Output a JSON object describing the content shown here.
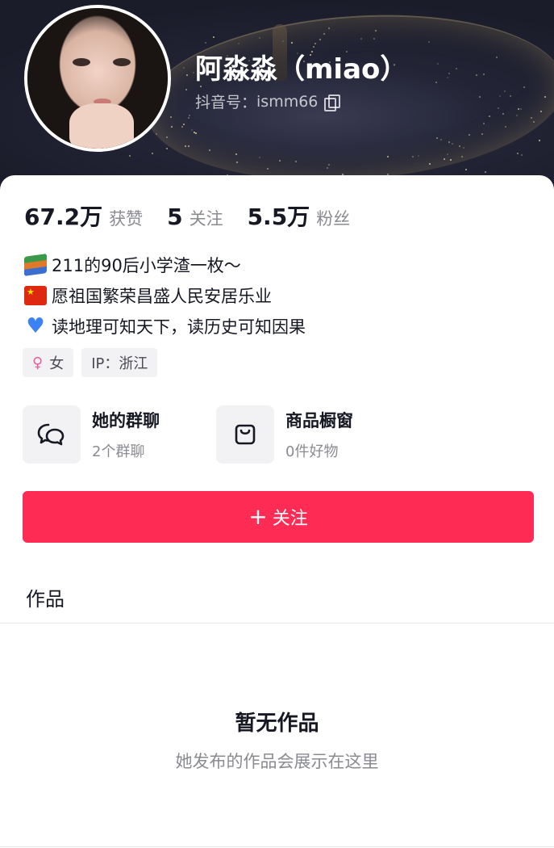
{
  "profile": {
    "nickname": "阿淼淼（miao）",
    "douyin_id_label": "抖音号：",
    "douyin_id": "ismm66"
  },
  "stats": [
    {
      "value": "67.2万",
      "label": "获赞"
    },
    {
      "value": "5",
      "label": "关注"
    },
    {
      "value": "5.5万",
      "label": "粉丝"
    }
  ],
  "bio": [
    {
      "icon": "books-icon",
      "text": "211的90后小学渣一枚～"
    },
    {
      "icon": "china-flag-icon",
      "text": "愿祖国繁荣昌盛人民安居乐业"
    },
    {
      "icon": "blue-heart-icon",
      "text": "读地理可知天下，读历史可知因果"
    }
  ],
  "tags": {
    "gender": "女",
    "ip": "IP：浙江"
  },
  "shortcuts": [
    {
      "icon": "chat-bubbles-icon",
      "title": "她的群聊",
      "subtitle": "2个群聊"
    },
    {
      "icon": "shopping-bag-icon",
      "title": "商品橱窗",
      "subtitle": "0件好物"
    }
  ],
  "follow_button": {
    "label": "关注"
  },
  "works_tab": {
    "label": "作品"
  },
  "empty_state": {
    "title": "暂无作品",
    "subtitle": "她发布的作品会展示在这里"
  },
  "colors": {
    "accent": "#fe2c55",
    "female": "#e85d9b"
  }
}
